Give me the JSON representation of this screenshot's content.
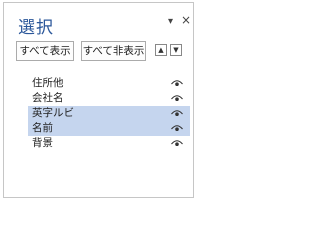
{
  "pane": {
    "title": "選択",
    "dropdown_glyph": "▾",
    "close_glyph": "×"
  },
  "toolbar": {
    "show_all_label": "すべて表示",
    "hide_all_label": "すべて非表示",
    "move_up_glyph": "▲",
    "move_down_glyph": "▼"
  },
  "items": [
    {
      "name": "住所他",
      "visible": true,
      "selected": false
    },
    {
      "name": "会社名",
      "visible": true,
      "selected": false
    },
    {
      "name": "英字ルビ",
      "visible": true,
      "selected": true
    },
    {
      "name": "名前",
      "visible": true,
      "selected": true
    },
    {
      "name": "背景",
      "visible": true,
      "selected": false
    }
  ],
  "colors": {
    "title": "#2b579a",
    "selection": "#c5d5ee"
  },
  "icons": {
    "visibility": "eye-icon"
  }
}
